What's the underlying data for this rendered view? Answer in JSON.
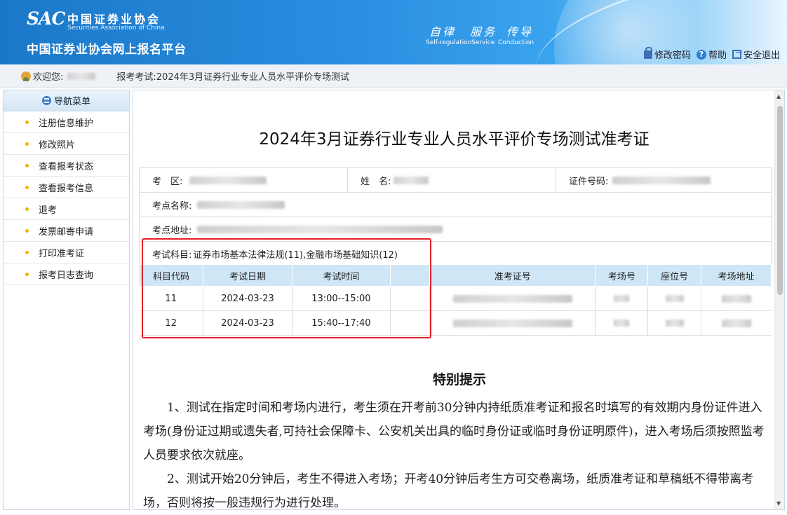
{
  "header": {
    "logo_mark": "SAC",
    "org_name_cn": "中国证券业协会",
    "org_name_en": "Securities Association of China",
    "platform_title": "中国证券业协会网上报名平台",
    "slogans": [
      {
        "cn": "自律",
        "en": "Self-regulation"
      },
      {
        "cn": "服务",
        "en": "Service"
      },
      {
        "cn": "传导",
        "en": "Conduction"
      }
    ],
    "links": {
      "change_password": "修改密码",
      "help": "帮助",
      "logout": "安全退出"
    }
  },
  "welcome_bar": {
    "welcome_label": "欢迎您:",
    "exam_label": "报考考试:",
    "exam_name": "2024年3月证券行业专业人员水平评价专场测试"
  },
  "sidebar": {
    "title": "导航菜单",
    "items": [
      {
        "label": "注册信息维护"
      },
      {
        "label": "修改照片"
      },
      {
        "label": "查看报考状态"
      },
      {
        "label": "查看报考信息"
      },
      {
        "label": "退考"
      },
      {
        "label": "发票邮寄申请"
      },
      {
        "label": "打印准考证"
      },
      {
        "label": "报考日志查询"
      }
    ]
  },
  "admission": {
    "title": "2024年3月证券行业专业人员水平评价专场测试准考证",
    "labels": {
      "region": "考　区:",
      "name": "姓　名:",
      "id_number": "证件号码:",
      "site_name": "考点名称:",
      "site_address": "考点地址:",
      "subjects_label": "考试科目:"
    },
    "subjects_value": "证券市场基本法律法规(11),金融市场基础知识(12)",
    "table": {
      "headers": [
        "科目代码",
        "考试日期",
        "考试时间",
        "",
        "准考证号",
        "考场号",
        "座位号",
        "考场地址"
      ],
      "rows": [
        {
          "code": "11",
          "date": "2024-03-23",
          "time": "13:00--15:00"
        },
        {
          "code": "12",
          "date": "2024-03-23",
          "time": "15:40--17:40"
        }
      ]
    }
  },
  "notice": {
    "title": "特别提示",
    "paragraphs": [
      "1、测试在指定时间和考场内进行，考生须在开考前30分钟内持纸质准考证和报名时填写的有效期内身份证件进入考场(身份证过期或遗失者,可持社会保障卡、公安机关出具的临时身份证或临时身份证明原件)，进入考场后须按照监考人员要求依次就座。",
      "2、测试开始20分钟后，考生不得进入考场；开考40分钟后考生方可交卷离场，纸质准考证和草稿纸不得带离考场，否则将按一般违规行为进行处理。"
    ]
  },
  "colors": {
    "header_blue": "#1b78c9",
    "table_header_bg": "#cfe6f6",
    "highlight_red": "#e2232a",
    "menu_bullet": "#f0b400"
  }
}
